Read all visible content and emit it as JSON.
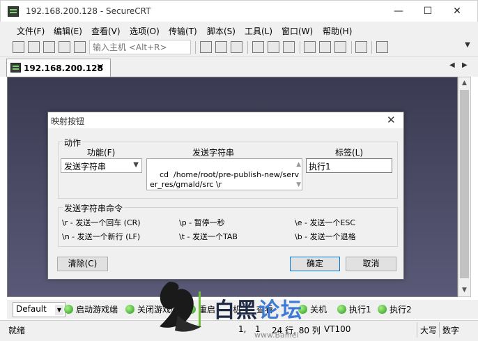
{
  "window": {
    "title": "192.168.200.128 - SecureCRT",
    "minimize": "—",
    "maximize": "☐",
    "close": "✕"
  },
  "menu": {
    "items": [
      "文件(F)",
      "编辑(E)",
      "查看(V)",
      "选项(O)",
      "传输(T)",
      "脚本(S)",
      "工具(L)",
      "窗口(W)",
      "帮助(H)"
    ]
  },
  "toolbar": {
    "host_placeholder": "输入主机 <Alt+R>",
    "overflow": "▼"
  },
  "tabs": {
    "active_label": "192.168.200.128",
    "close": "✕",
    "nav_left": "◀",
    "nav_right": "▶"
  },
  "dialog": {
    "title": "映射按钮",
    "close": "✕",
    "action_group": "动作",
    "function_label": "功能(F)",
    "function_value": "发送字符串",
    "combo_arrow": "▼",
    "send_string_label": "发送字符串",
    "send_string_value": "cd  /home/root/pre-publish-new/server_res/gmald/src \\r",
    "scroll_up": "▲",
    "scroll_down": "▼",
    "tag_label": "标签(L)",
    "tag_value": "执行1",
    "commands_group": "发送字符串命令",
    "commands": [
      "\\r - 发送一个回车 (CR)",
      "\\p - 暂停一秒",
      "\\e - 发送一个ESC",
      "\\n - 发送一个新行 (LF)",
      "\\t - 发送一个TAB",
      "\\b - 发送一个退格"
    ],
    "clear_button": "清除(C)",
    "ok_button": "确定",
    "cancel_button": "取消"
  },
  "button_bar": {
    "session": "Default",
    "arrow": "▼",
    "buttons": [
      "启动游戏端",
      "关闭游戏端",
      "重启",
      "机",
      "查看",
      "关机",
      "执行1",
      "执行2"
    ]
  },
  "status_bar": {
    "status": "就绪",
    "position_row": "1,",
    "position_col": "1",
    "size": "24 行, 80 列",
    "terminal_type": "VT100",
    "caps": "大写",
    "num": "数字"
  },
  "watermark": {
    "text_part1": "白黑",
    "text_part2": "论坛",
    "url": "www.Baihei"
  },
  "colors": {
    "accent": "#0078d7",
    "terminal_bg": "#4a4a66",
    "green_dot": "#2a9a1a"
  }
}
